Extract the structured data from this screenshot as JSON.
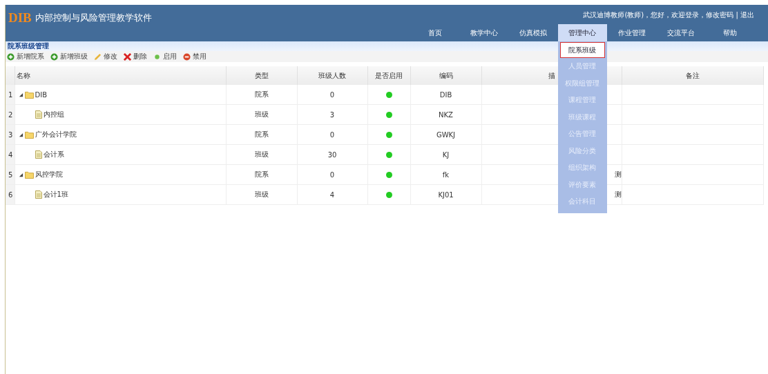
{
  "header": {
    "logo": "DIB",
    "title": "内部控制与风险管理教学软件",
    "user_info": "武汉迪博教师(教师)，您好，欢迎登录，修改密码 | 退出"
  },
  "nav": [
    {
      "label": "首页",
      "selected": false
    },
    {
      "label": "教学中心",
      "selected": false
    },
    {
      "label": "仿真模拟",
      "selected": false
    },
    {
      "label": "管理中心",
      "selected": true
    },
    {
      "label": "作业管理",
      "selected": false
    },
    {
      "label": "交流平台",
      "selected": false
    },
    {
      "label": "帮助",
      "selected": false
    }
  ],
  "dropdown": [
    {
      "label": "院系班级",
      "selected": true
    },
    {
      "label": "人员管理",
      "selected": false
    },
    {
      "label": "权限组管理",
      "selected": false
    },
    {
      "label": "课程管理",
      "selected": false
    },
    {
      "label": "班级课程",
      "selected": false
    },
    {
      "label": "公告管理",
      "selected": false
    },
    {
      "label": "风险分类",
      "selected": false
    },
    {
      "label": "组织架构",
      "selected": false
    },
    {
      "label": "评价要素",
      "selected": false
    },
    {
      "label": "会计科目",
      "selected": false
    }
  ],
  "panel_title": "院系班级管理",
  "toolbar": [
    {
      "kind": "add",
      "label": "新增院系"
    },
    {
      "kind": "add",
      "label": "新增班级"
    },
    {
      "kind": "edit",
      "label": "修改"
    },
    {
      "kind": "delete",
      "label": "删除"
    },
    {
      "kind": "enable",
      "label": "启用"
    },
    {
      "kind": "disable",
      "label": "禁用"
    }
  ],
  "table": {
    "columns": [
      "名称",
      "类型",
      "班级人数",
      "是否启用",
      "编码",
      "描",
      "备注"
    ],
    "rows": [
      {
        "num": "1",
        "name": "DIB",
        "type": "院系",
        "count": "0",
        "enabled": true,
        "code": "DIB",
        "expanded": true,
        "children": [
          {
            "num": "2",
            "name": "内控组",
            "type": "班级",
            "count": "3",
            "enabled": true,
            "code": "NKZ"
          }
        ]
      },
      {
        "num": "3",
        "name": "广外会计学院",
        "type": "院系",
        "count": "0",
        "enabled": true,
        "code": "GWKJ",
        "expanded": true,
        "children": [
          {
            "num": "4",
            "name": "会计系",
            "type": "班级",
            "count": "30",
            "enabled": true,
            "code": "KJ"
          }
        ]
      },
      {
        "num": "5",
        "name": "风控学院",
        "type": "院系",
        "count": "0",
        "enabled": true,
        "code": "fk",
        "description": "测",
        "expanded": true,
        "children": [
          {
            "num": "6",
            "name": "会计1班",
            "type": "班级",
            "count": "4",
            "enabled": true,
            "code": "KJ01",
            "description": "测"
          }
        ]
      }
    ]
  }
}
